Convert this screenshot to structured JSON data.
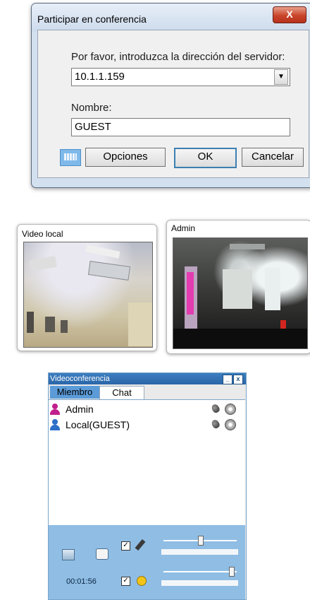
{
  "dialog": {
    "title": "Participar en conferencia",
    "close_symbol": "X",
    "server_label": "Por favor, introduzca la dirección del servidor:",
    "server_value": "10.1.1.159",
    "name_label": "Nombre:",
    "name_value": "GUEST",
    "options_label": "Opciones",
    "ok_label": "OK",
    "cancel_label": "Cancelar",
    "keyboard_icon": "keyboard-icon"
  },
  "video_local": {
    "title": "Video local"
  },
  "video_admin": {
    "title": "Admin"
  },
  "videoconference": {
    "title": "Videoconferencia",
    "minimize_symbol": "_",
    "close_symbol": "x",
    "tabs": [
      {
        "label": "Miembro",
        "active": true
      },
      {
        "label": "Chat",
        "active": false
      }
    ],
    "members": [
      {
        "name": "Admin",
        "icon_color": "#c0208c"
      },
      {
        "name": "Local(GUEST)",
        "icon_color": "#2b6fc8"
      }
    ],
    "controls": {
      "timer": "00:01:56",
      "mic_checked": true,
      "speaker_checked": true,
      "mic_volume": 0.5,
      "speaker_volume": 0.95,
      "check_symbol": "✓"
    }
  },
  "colors": {
    "titlebar_blue": "#2a66a8",
    "bottom_panel": "#8fbde4",
    "close_red": "#c9452a"
  }
}
